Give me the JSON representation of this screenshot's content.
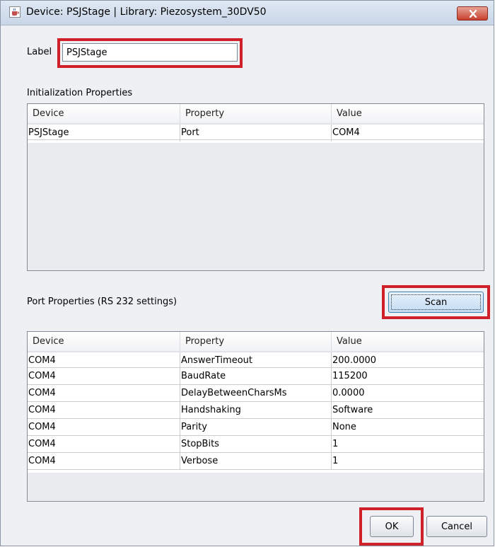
{
  "window": {
    "title": "Device: PSJStage | Library: Piezosystem_30DV50",
    "colors": {
      "highlight": "#d0202a",
      "title_bar": "#c9d6e8",
      "close": "#c7402f"
    }
  },
  "label_field": {
    "label": "Label",
    "value": "PSJStage"
  },
  "init_props": {
    "heading": "Initialization Properties",
    "columns": [
      "Device",
      "Property",
      "Value"
    ],
    "rows": [
      [
        "PSJStage",
        "Port",
        "COM4"
      ]
    ]
  },
  "port_props": {
    "heading": "Port Properties (RS 232 settings)",
    "scan_label": "Scan",
    "columns": [
      "Device",
      "Property",
      "Value"
    ],
    "rows": [
      [
        "COM4",
        "AnswerTimeout",
        "200.0000"
      ],
      [
        "COM4",
        "BaudRate",
        "115200"
      ],
      [
        "COM4",
        "DelayBetweenCharsMs",
        "0.0000"
      ],
      [
        "COM4",
        "Handshaking",
        "Software"
      ],
      [
        "COM4",
        "Parity",
        "None"
      ],
      [
        "COM4",
        "StopBits",
        "1"
      ],
      [
        "COM4",
        "Verbose",
        "1"
      ]
    ]
  },
  "buttons": {
    "ok": "OK",
    "cancel": "Cancel"
  },
  "icons": {
    "app": "java-cup-icon",
    "close": "close-icon"
  }
}
